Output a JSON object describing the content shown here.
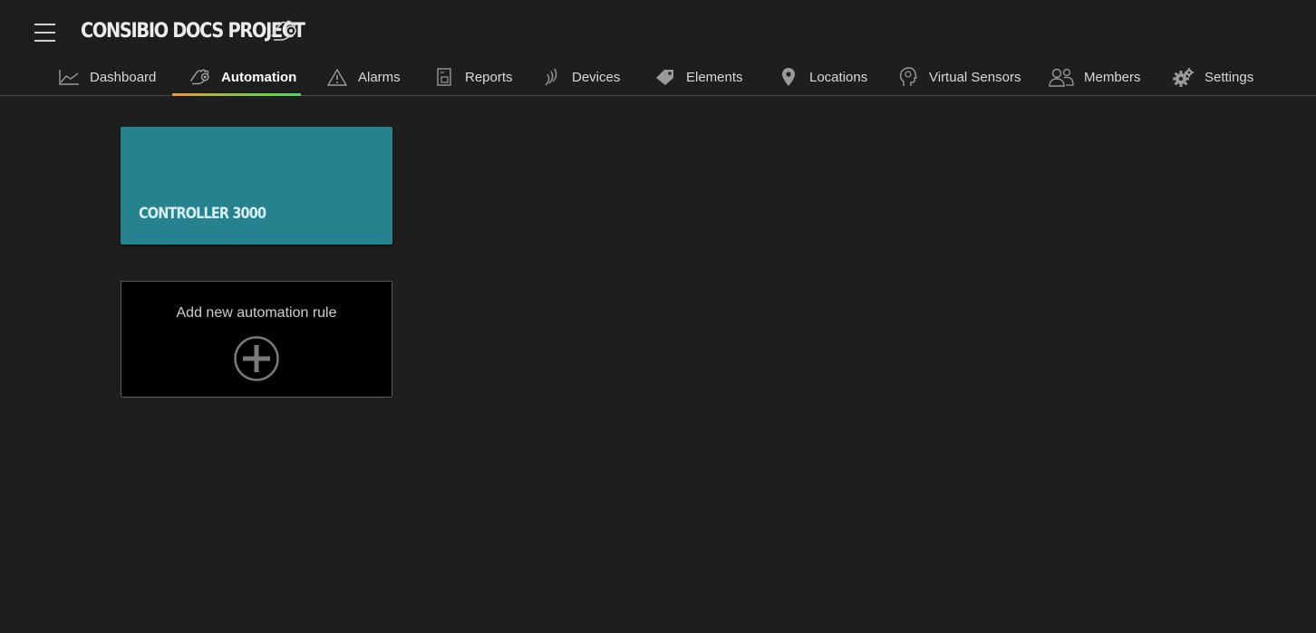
{
  "header": {
    "project_title": "CONSIBIO DOCS PROJECT",
    "menu_icon": "hamburger-menu-icon",
    "title_icon": "automation-hand-icon"
  },
  "nav": {
    "active_tab": "Automation",
    "accent_gradient": [
      "#e89a3a",
      "#5fd35f"
    ],
    "tabs": [
      {
        "label": "Dashboard",
        "icon": "chart-line-icon"
      },
      {
        "label": "Automation",
        "icon": "automation-hand-icon"
      },
      {
        "label": "Alarms",
        "icon": "warning-triangle-icon"
      },
      {
        "label": "Reports",
        "icon": "report-document-icon"
      },
      {
        "label": "Devices",
        "icon": "wireless-signal-icon"
      },
      {
        "label": "Elements",
        "icon": "tag-icon"
      },
      {
        "label": "Locations",
        "icon": "map-pin-icon"
      },
      {
        "label": "Virtual Sensors",
        "icon": "virtual-sensor-head-icon"
      },
      {
        "label": "Members",
        "icon": "users-icon"
      },
      {
        "label": "Settings",
        "icon": "gears-icon"
      }
    ]
  },
  "main": {
    "rules": [
      {
        "name": "CONTROLLER 3000",
        "color": "#26828e"
      }
    ],
    "add_rule": {
      "label": "Add new automation rule",
      "icon": "plus-circle-icon"
    }
  }
}
